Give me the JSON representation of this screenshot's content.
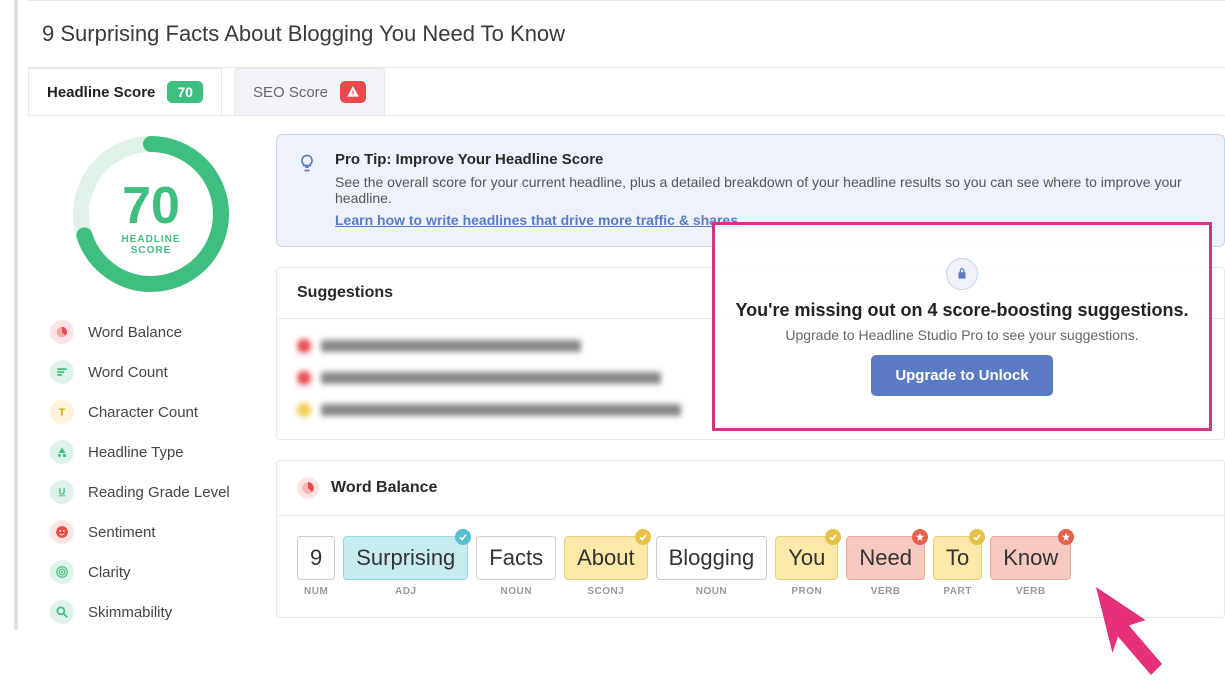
{
  "headline": "9 Surprising Facts About Blogging You Need To Know",
  "tabs": {
    "headline_score": {
      "label": "Headline Score",
      "score": "70"
    },
    "seo_score": {
      "label": "SEO Score"
    }
  },
  "score_circle": {
    "value": "70",
    "label": "HEADLINE\nSCORE"
  },
  "nav": [
    {
      "label": "Word Balance",
      "icon": "chart-icon",
      "cls": "ni-red"
    },
    {
      "label": "Word Count",
      "icon": "lines-icon",
      "cls": "ni-green"
    },
    {
      "label": "Character Count",
      "icon": "type-icon",
      "cls": "ni-yellow"
    },
    {
      "label": "Headline Type",
      "icon": "shapes-icon",
      "cls": "ni-green"
    },
    {
      "label": "Reading Grade Level",
      "icon": "underline-icon",
      "cls": "ni-green"
    },
    {
      "label": "Sentiment",
      "icon": "smile-icon",
      "cls": "ni-red"
    },
    {
      "label": "Clarity",
      "icon": "target-icon",
      "cls": "ni-green"
    },
    {
      "label": "Skimmability",
      "icon": "search-icon",
      "cls": "ni-green"
    }
  ],
  "protip": {
    "title": "Pro Tip: Improve Your Headline Score",
    "text": "See the overall score for your current headline, plus a detailed breakdown of your headline results so you can see where to improve your headline.",
    "link": "Learn how to write headlines that drive more traffic & shares."
  },
  "suggestions": {
    "header": "Suggestions",
    "overlay": {
      "headline": "You're missing out on 4 score-boosting suggestions.",
      "sub": "Upgrade to Headline Studio Pro to see your suggestions.",
      "button": "Upgrade to Unlock"
    }
  },
  "word_balance": {
    "header": "Word Balance",
    "words": [
      {
        "text": "9",
        "pos": "NUM",
        "cls": "wb-white",
        "badge": ""
      },
      {
        "text": "Surprising",
        "pos": "ADJ",
        "cls": "wb-blue",
        "badge": "check-b"
      },
      {
        "text": "Facts",
        "pos": "NOUN",
        "cls": "wb-white",
        "badge": ""
      },
      {
        "text": "About",
        "pos": "SCONJ",
        "cls": "wb-yellow",
        "badge": "check-y"
      },
      {
        "text": "Blogging",
        "pos": "NOUN",
        "cls": "wb-white",
        "badge": ""
      },
      {
        "text": "You",
        "pos": "PRON",
        "cls": "wb-yellow",
        "badge": "check-y"
      },
      {
        "text": "Need",
        "pos": "VERB",
        "cls": "wb-red",
        "badge": "star"
      },
      {
        "text": "To",
        "pos": "PART",
        "cls": "wb-yellow",
        "badge": "check-y"
      },
      {
        "text": "Know",
        "pos": "VERB",
        "cls": "wb-red",
        "badge": "star"
      }
    ]
  }
}
